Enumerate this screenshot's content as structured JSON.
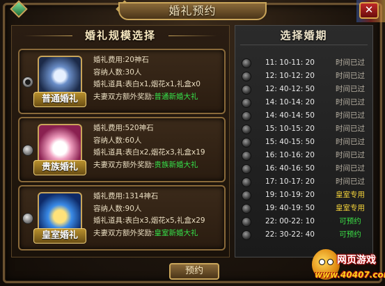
{
  "window": {
    "title": "婚礼预约",
    "close_label": "✕"
  },
  "left": {
    "header": "婚礼规模选择",
    "options": [
      {
        "name": "普通婚礼",
        "icon": "ring-icon",
        "selected": true,
        "cost": "婚礼费用:20神石",
        "capacity": "容纳人数:30人",
        "props": "婚礼道具:表白x1,烟花x1,礼盒x0",
        "reward_prefix": "夫妻双方额外奖励:",
        "reward": "普通新婚大礼"
      },
      {
        "name": "贵族婚礼",
        "icon": "cake-icon",
        "selected": false,
        "cost": "婚礼费用:520神石",
        "capacity": "容纳人数:60人",
        "props": "婚礼道具:表白x2,烟花x3,礼盒x19",
        "reward_prefix": "夫妻双方额外奖励:",
        "reward": "贵族新婚大礼"
      },
      {
        "name": "皇室婚礼",
        "icon": "crown-icon",
        "selected": false,
        "cost": "婚礼费用:1314神石",
        "capacity": "容纳人数:90人",
        "props": "婚礼道具:表白x3,烟花x5,礼盒x29",
        "reward_prefix": "夫妻双方额外奖励:",
        "reward": "皇室新婚大礼"
      }
    ]
  },
  "right": {
    "header": "选择婚期",
    "slots": [
      {
        "time": "11: 10-11: 20",
        "status": "时间已过",
        "kind": "expired"
      },
      {
        "time": "12: 10-12: 20",
        "status": "时间已过",
        "kind": "expired"
      },
      {
        "time": "12: 40-12: 50",
        "status": "时间已过",
        "kind": "expired"
      },
      {
        "time": "14: 10-14: 20",
        "status": "时间已过",
        "kind": "expired"
      },
      {
        "time": "14: 40-14: 50",
        "status": "时间已过",
        "kind": "expired"
      },
      {
        "time": "15: 10-15: 20",
        "status": "时间已过",
        "kind": "expired"
      },
      {
        "time": "15: 40-15: 50",
        "status": "时间已过",
        "kind": "expired"
      },
      {
        "time": "16: 10-16: 20",
        "status": "时间已过",
        "kind": "expired"
      },
      {
        "time": "16: 40-16: 50",
        "status": "时间已过",
        "kind": "expired"
      },
      {
        "time": "17: 10-17: 20",
        "status": "时间已过",
        "kind": "expired"
      },
      {
        "time": "19: 10-19: 20",
        "status": "皇室专用",
        "kind": "royal"
      },
      {
        "time": "19: 40-19: 50",
        "status": "皇室专用",
        "kind": "royal"
      },
      {
        "time": "22: 00-22: 10",
        "status": "可预约",
        "kind": "open"
      },
      {
        "time": "22: 30-22: 40",
        "status": "可预约",
        "kind": "open"
      }
    ]
  },
  "confirm_label": "预约",
  "watermark": {
    "title": "网页游戏",
    "url": "www.40407.com"
  },
  "colors": {
    "expired": "#b9b2a4",
    "royal": "#f3d23a",
    "open": "#3be046",
    "reward": "#36e24a"
  }
}
